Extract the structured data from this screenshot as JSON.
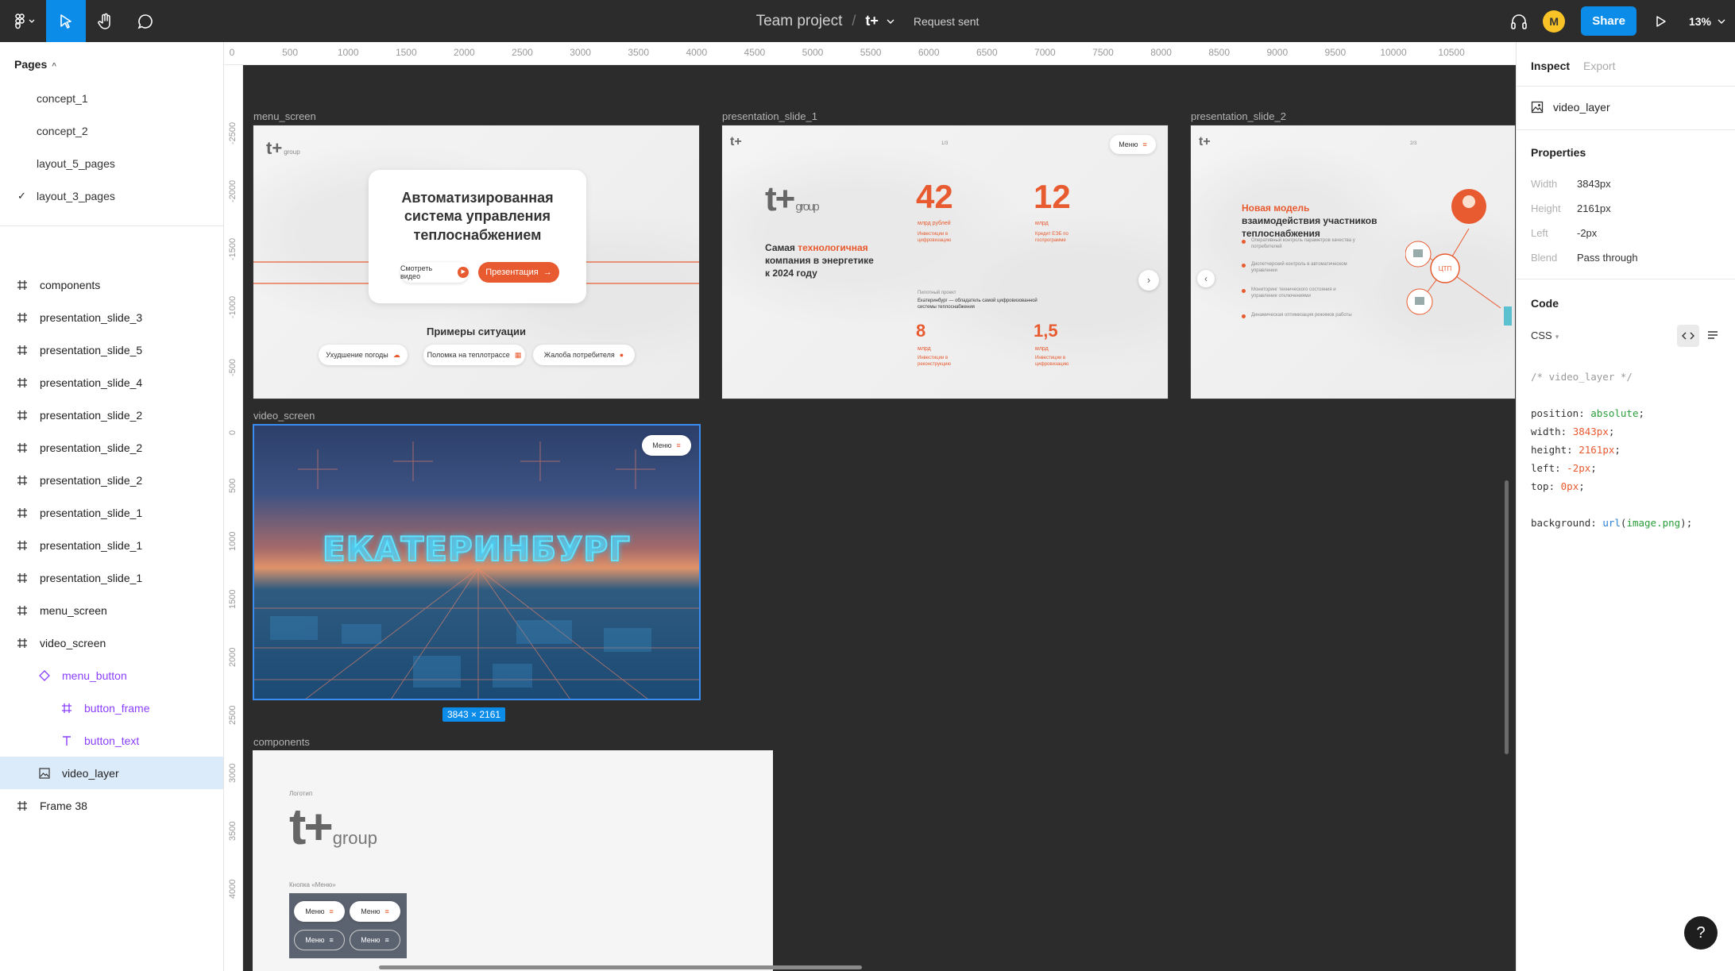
{
  "topbar": {
    "file_name": "Team project",
    "separator": "/",
    "project": "t+",
    "request": "Request sent",
    "avatar": "M",
    "share": "Share",
    "zoom": "13%"
  },
  "pages": {
    "header": "Pages",
    "items": [
      {
        "label": "concept_1",
        "checked": false
      },
      {
        "label": "concept_2",
        "checked": false
      },
      {
        "label": "layout_5_pages",
        "checked": false
      },
      {
        "label": "layout_3_pages",
        "checked": true
      }
    ]
  },
  "layers": [
    {
      "label": "components",
      "icon": "frame-icon"
    },
    {
      "label": "presentation_slide_3",
      "icon": "frame-icon"
    },
    {
      "label": "presentation_slide_5",
      "icon": "frame-icon"
    },
    {
      "label": "presentation_slide_4",
      "icon": "frame-icon"
    },
    {
      "label": "presentation_slide_2",
      "icon": "frame-icon"
    },
    {
      "label": "presentation_slide_2",
      "icon": "frame-icon"
    },
    {
      "label": "presentation_slide_2",
      "icon": "frame-icon"
    },
    {
      "label": "presentation_slide_1",
      "icon": "frame-icon"
    },
    {
      "label": "presentation_slide_1",
      "icon": "frame-icon"
    },
    {
      "label": "presentation_slide_1",
      "icon": "frame-icon"
    },
    {
      "label": "menu_screen",
      "icon": "frame-icon"
    },
    {
      "label": "video_screen",
      "icon": "frame-icon"
    },
    {
      "label": "menu_button",
      "icon": "component-icon"
    },
    {
      "label": "button_frame",
      "icon": "frame-icon"
    },
    {
      "label": "button_text",
      "icon": "text-icon"
    },
    {
      "label": "video_layer",
      "icon": "image-icon"
    },
    {
      "label": "Frame 38",
      "icon": "frame-icon"
    }
  ],
  "ruler": {
    "top": [
      "0",
      "500",
      "1000",
      "1500",
      "2000",
      "2500",
      "3000",
      "3500",
      "4000",
      "4500",
      "5000",
      "5500",
      "6000",
      "6500",
      "7000",
      "7500",
      "8000",
      "8500",
      "9000",
      "9500",
      "10000",
      "10500"
    ],
    "left": [
      "-2500",
      "-2000",
      "-1500",
      "-1000",
      "-500",
      "0",
      "500",
      "1000",
      "1500",
      "2000",
      "2500",
      "3000",
      "3500",
      "4000"
    ]
  },
  "frames": {
    "menu_screen": {
      "label": "menu_screen",
      "title": "Автоматизированная система управления теплоснабжением",
      "watch_video": "Смотреть видео",
      "presentation": "Презентация",
      "examples_title": "Примеры ситуации",
      "examples": [
        "Ухудшение погоды",
        "Поломка на теплотрассе",
        "Жалоба потребителя"
      ],
      "brand": "t+",
      "brand_sub": "group"
    },
    "slide_1": {
      "label": "presentation_slide_1",
      "page": "1/3",
      "menu": "Меню",
      "headline_pre": "Самая ",
      "headline_hl": "технологичная",
      "headline_post": " компания в энергетике к 2024 году",
      "num1": "42",
      "num1_cap": "млрд рублей",
      "num1_sub": "Инвестиции в цифровизацию",
      "num2": "12",
      "num2_cap": "млрд",
      "num2_sub": "Кредит ЕЭБ по госпрограмме",
      "num3": "8",
      "num3_cap": "млрд",
      "num3_sub": "Инвестиции в реконструкцию",
      "num4": "1,5",
      "num4_cap": "млрд",
      "num4_sub": "Инвестиции в цифровизацию",
      "pilot_label": "Пилотный проект",
      "pilot_text": "Екатеринбург — обладатель самой цифровизованной системы теплоснабжения",
      "brand": "t+",
      "brand_sub": "group"
    },
    "slide_2": {
      "label": "presentation_slide_2",
      "page": "2/3",
      "headline_hl": "Новая модель",
      "headline_post": " взаимодействия участников теплоснабжения",
      "bullets": [
        "Оперативный контроль параметров качества у потребителей",
        "Диспетчерский контроль в автоматическом управлении",
        "Мониторинг технического состояния и управление отключениями",
        "Динамическая оптимизация режимов работы"
      ],
      "node": "ЦТП",
      "brand": "t+"
    },
    "video_screen": {
      "label": "video_screen",
      "city": "ЕКАТЕРИНБУРГ",
      "menu": "Меню",
      "dimensions": "3843 × 2161"
    },
    "components": {
      "label": "components",
      "logo_label": "Логотип",
      "button_label": "Кнопка «Меню»",
      "menu": "Меню",
      "brand": "t+",
      "brand_sub": "group"
    }
  },
  "inspect": {
    "tab_inspect": "Inspect",
    "tab_export": "Export",
    "layer": "video_layer",
    "properties_title": "Properties",
    "props": [
      {
        "k": "Width",
        "v": "3843px"
      },
      {
        "k": "Height",
        "v": "2161px"
      },
      {
        "k": "Left",
        "v": "-2px"
      },
      {
        "k": "Blend",
        "v": "Pass through"
      }
    ],
    "code_title": "Code",
    "lang": "CSS",
    "code_comment": "/* video_layer */",
    "code_lines": [
      {
        "prop": "position",
        "val": "absolute",
        "cls": "c-kw"
      },
      {
        "prop": "width",
        "val": "3843px",
        "cls": "c-num"
      },
      {
        "prop": "height",
        "val": "2161px",
        "cls": "c-num"
      },
      {
        "prop": "left",
        "val": "-2px",
        "cls": "c-num"
      },
      {
        "prop": "top",
        "val": "0px",
        "cls": "c-num"
      }
    ],
    "bg_prop": "background",
    "bg_fn": "url",
    "bg_arg": "image.png"
  },
  "help": "?",
  "colors": {
    "accent": "#0c8ce9",
    "brand_orange": "#e85a2f",
    "canvas": "#2c2c2c",
    "selection": "#dcebfa"
  }
}
